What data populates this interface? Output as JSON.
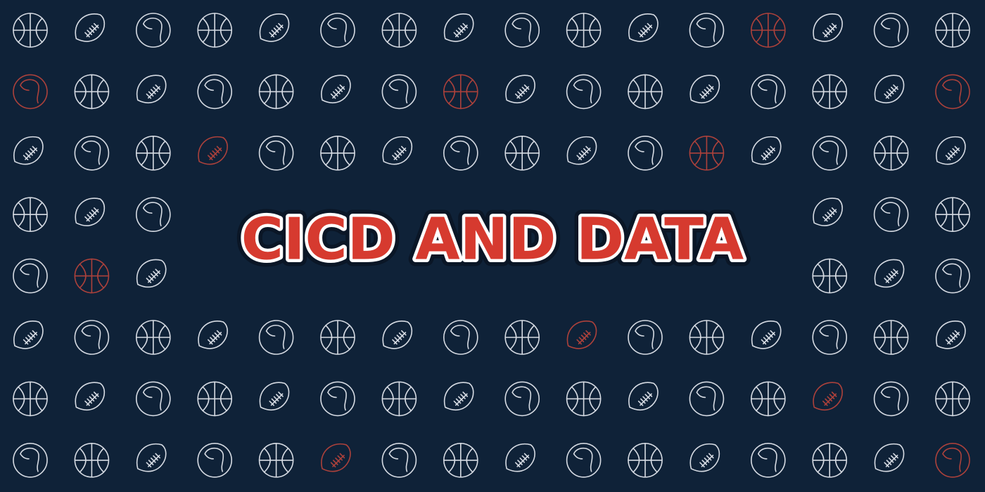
{
  "banner": {
    "title": "CICD AND DATA"
  },
  "colors": {
    "background": "#0f2238",
    "icon_stroke": "#e7ebf2",
    "icon_accent": "#c8473c",
    "title_fill": "#d63a2f",
    "title_inner_stroke": "#ffffff",
    "title_outer_stroke": "#0a1626"
  },
  "pattern": {
    "icon_cycle": [
      "basketball-icon",
      "football-icon",
      "baseball-icon"
    ],
    "accent_cells": [
      "0-12",
      "1-0",
      "1-7",
      "1-15",
      "2-3",
      "2-11",
      "4-1",
      "5-9",
      "6-13",
      "7-5",
      "7-15"
    ]
  }
}
